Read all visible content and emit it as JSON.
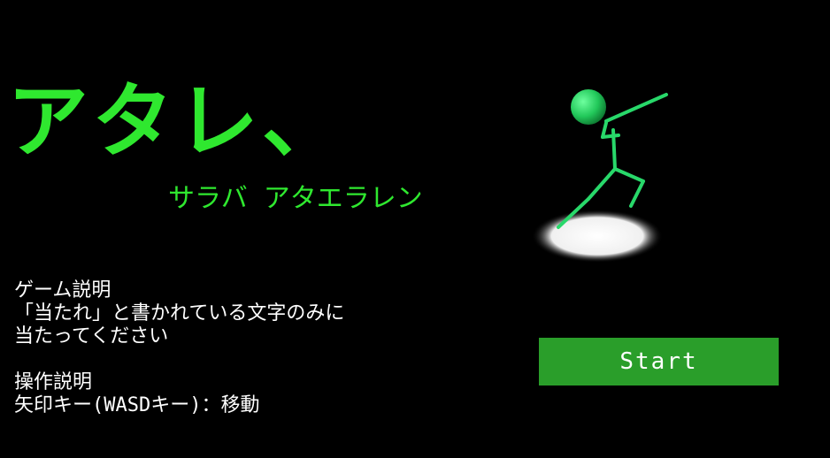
{
  "title": "アタレ、",
  "subtitle": "サラバ アタエラレン",
  "instructions": {
    "game_heading": "ゲーム説明",
    "game_line1": "「当たれ」と書かれている文字のみに",
    "game_line2": "当たってください",
    "controls_heading": "操作説明",
    "controls_line1": "矢印キー(WASDキー)：移動"
  },
  "start_button": {
    "label": "Start"
  },
  "colors": {
    "accent": "#2fe82f",
    "button": "#2a9e2a",
    "background": "#000000",
    "text": "#ffffff"
  },
  "icons": {
    "figure": "stick-figure-icon"
  }
}
